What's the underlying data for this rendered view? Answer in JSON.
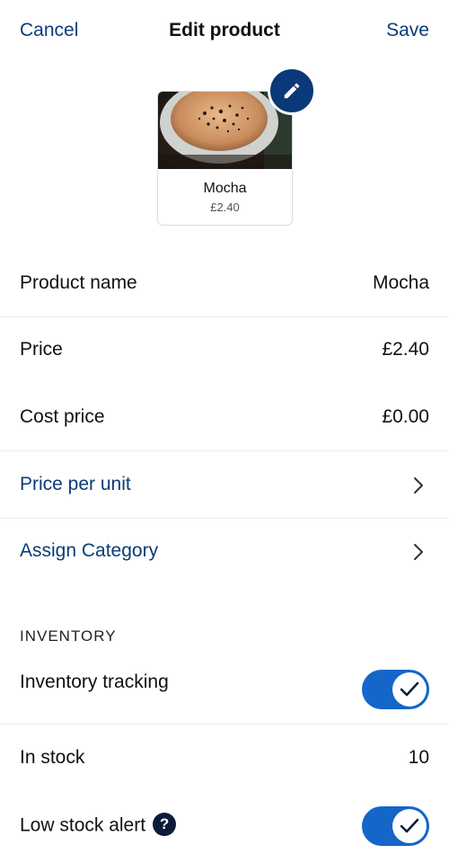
{
  "nav": {
    "cancel_label": "Cancel",
    "title": "Edit product",
    "save_label": "Save"
  },
  "product_card": {
    "name": "Mocha",
    "price": "£2.40",
    "edit_icon": "pencil-icon"
  },
  "fields": {
    "product_name": {
      "label": "Product name",
      "value": "Mocha"
    },
    "price": {
      "label": "Price",
      "value": "£2.40"
    },
    "cost_price": {
      "label": "Cost price",
      "value": "£0.00"
    },
    "price_per_unit": {
      "label": "Price per unit",
      "icon": "chevron-right-icon"
    },
    "assign_category": {
      "label": "Assign Category",
      "icon": "chevron-right-icon"
    }
  },
  "inventory": {
    "section_title": "INVENTORY",
    "tracking": {
      "label": "Inventory tracking",
      "enabled": true
    },
    "in_stock": {
      "label": "In stock",
      "value": "10"
    },
    "low_stock_alert": {
      "label": "Low stock alert",
      "help_glyph": "?",
      "enabled": true
    }
  },
  "colors": {
    "link": "#0a3c78",
    "toggle_on": "#1466c8",
    "edit_button": "#0a3878"
  }
}
